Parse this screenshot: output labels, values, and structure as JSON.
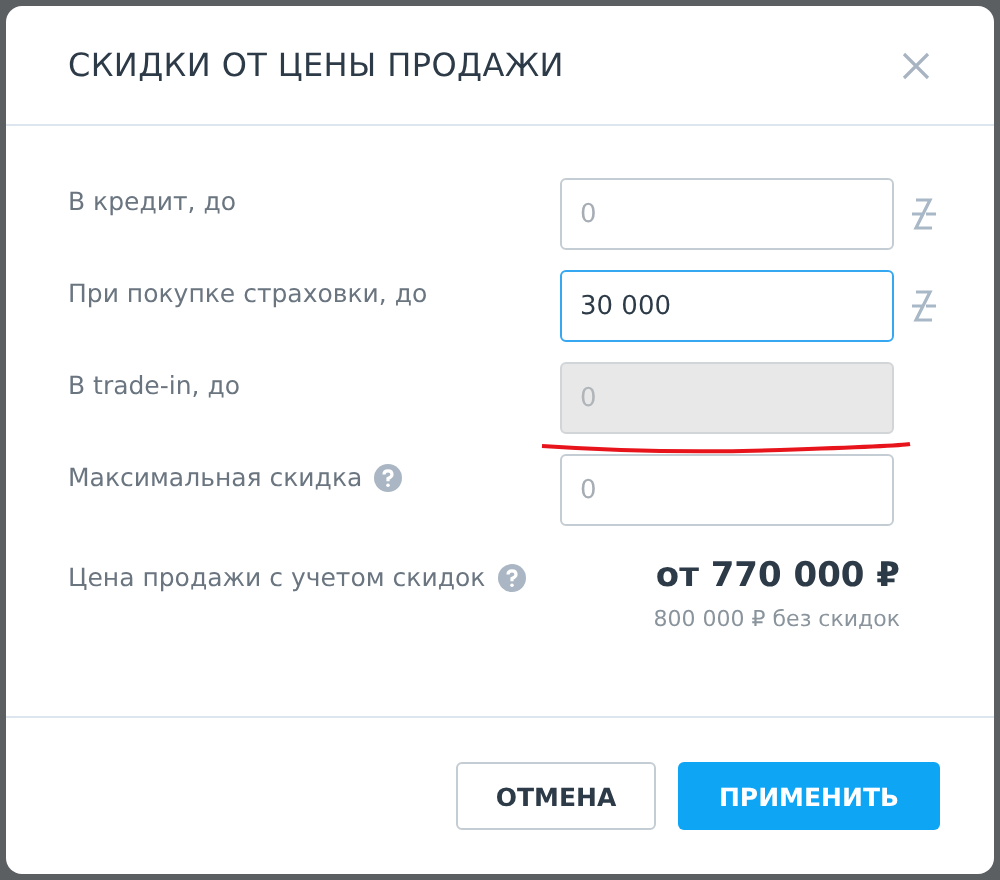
{
  "dialog": {
    "title": "СКИДКИ ОТ ЦЕНЫ ПРОДАЖИ"
  },
  "fields": [
    {
      "label": "В кредит, до",
      "placeholder": "0",
      "focused": false,
      "disabled": false,
      "unlinked": true,
      "help": false,
      "underlined": false
    },
    {
      "label": "При покупке страховки, до",
      "value": "30 000",
      "focused": true,
      "disabled": false,
      "unlinked": true,
      "help": false,
      "underlined": false
    },
    {
      "label": "В trade-in, до",
      "placeholder": "0",
      "focused": false,
      "disabled": true,
      "unlinked": false,
      "help": false,
      "underlined": true
    },
    {
      "label": "Максимальная скидка",
      "placeholder": "0",
      "focused": false,
      "disabled": false,
      "unlinked": false,
      "help": true,
      "underlined": false
    }
  ],
  "summary": {
    "label": "Цена продажи с учетом скидок",
    "help": true,
    "price": "от 770 000 ₽",
    "note": "800 000 ₽ без скидок"
  },
  "buttons": [
    {
      "label": "ОТМЕНА",
      "kind": "secondary"
    },
    {
      "label": "ПРИМЕНИТЬ",
      "kind": "primary"
    }
  ]
}
